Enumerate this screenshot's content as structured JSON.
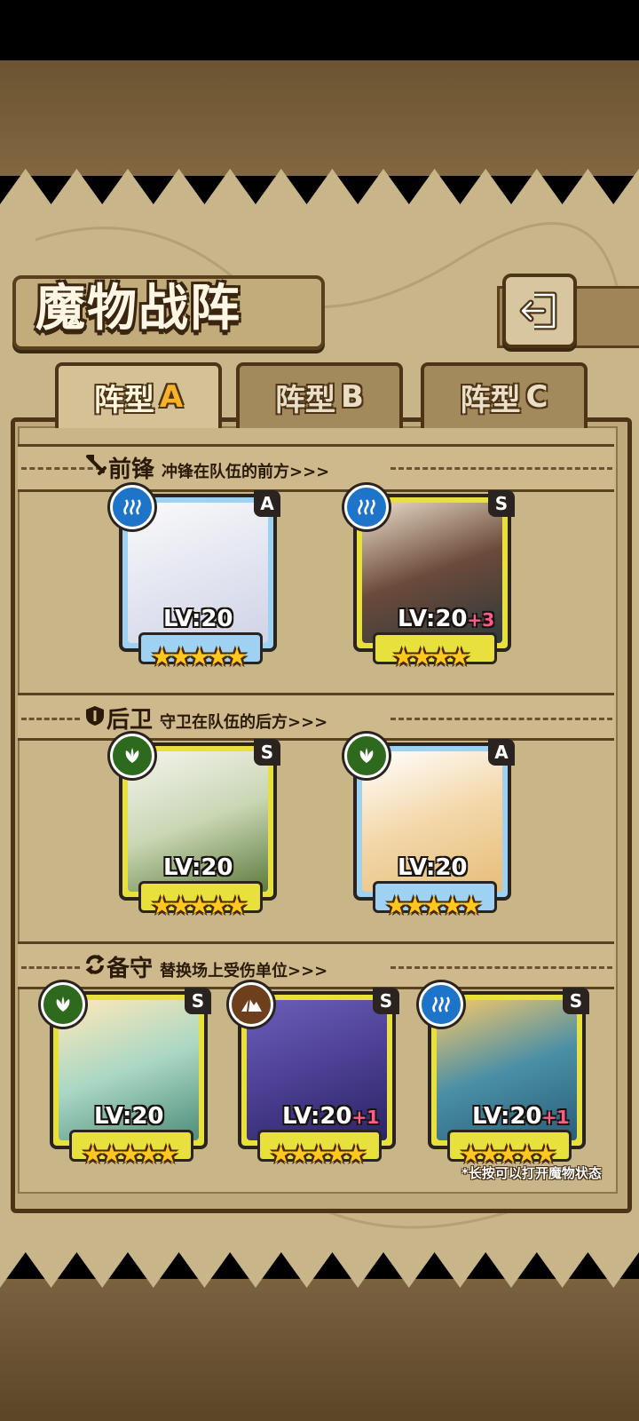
{
  "title": "魔物战阵",
  "back_button": {
    "icon": "return-arrow-icon"
  },
  "tabs": [
    {
      "label": "阵型",
      "suffix": "A",
      "active": true
    },
    {
      "label": "阵型",
      "suffix": "B",
      "active": false
    },
    {
      "label": "阵型",
      "suffix": "C",
      "active": false
    }
  ],
  "sections": {
    "front": {
      "title": "前锋",
      "desc": "冲锋在队伍的前方>>>",
      "icon": "sword-icon"
    },
    "back": {
      "title": "后卫",
      "desc": "守卫在队伍的后方>>>",
      "icon": "shield-icon"
    },
    "reserve": {
      "title": "备守",
      "desc": "替换场上受伤单位>>>",
      "icon": "swap-icon"
    }
  },
  "monsters": {
    "front": [
      {
        "level": "LV:20",
        "plus": "",
        "rank": "A",
        "element": "water",
        "stars": "★★★★★"
      },
      {
        "level": "LV:20",
        "plus": "+3",
        "rank": "S",
        "element": "water",
        "stars": "★★★★"
      }
    ],
    "back": [
      {
        "level": "LV:20",
        "plus": "",
        "rank": "S",
        "element": "nature",
        "stars": "★★★★★"
      },
      {
        "level": "LV:20",
        "plus": "",
        "rank": "A",
        "element": "nature",
        "stars": "★★★★★"
      }
    ],
    "reserve": [
      {
        "level": "LV:20",
        "plus": "",
        "rank": "S",
        "element": "nature",
        "stars": "★★★★★"
      },
      {
        "level": "LV:20",
        "plus": "+1",
        "rank": "S",
        "element": "earth",
        "stars": "★★★★★"
      },
      {
        "level": "LV:20",
        "plus": "+1",
        "rank": "S",
        "element": "water",
        "stars": "★★★★★"
      }
    ]
  },
  "footer_note": "*长按可以打开魔物状态",
  "colors": {
    "parchment": "#c9b58a",
    "frame_dark": "#4d3416",
    "accent_gold": "#f7b225",
    "star": "#ffc820",
    "rank_A": "#9fd1f2",
    "rank_S": "#e8e13d"
  }
}
